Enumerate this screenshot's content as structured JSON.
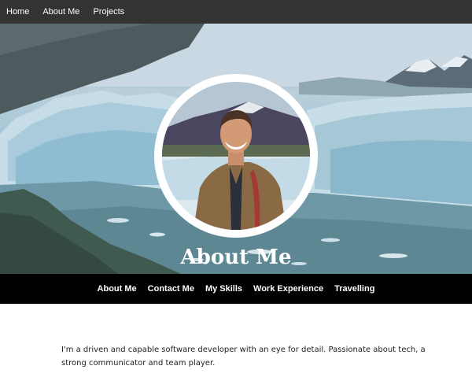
{
  "top_nav": {
    "items": [
      {
        "label": "Home"
      },
      {
        "label": "About Me"
      },
      {
        "label": "Projects"
      }
    ]
  },
  "hero": {
    "title": "About Me",
    "background_icon": "glacier-landscape",
    "avatar_icon": "profile-photo"
  },
  "section_nav": {
    "items": [
      {
        "label": "About Me"
      },
      {
        "label": "Contact Me"
      },
      {
        "label": "My Skills"
      },
      {
        "label": "Work Experience"
      },
      {
        "label": "Travelling"
      }
    ]
  },
  "main": {
    "bio": "I'm a driven and capable software developer with an eye for detail. Passionate about tech, a strong communicator and team player."
  },
  "colors": {
    "top_nav_bg": "#333333",
    "section_nav_bg": "#000000",
    "text": "#222222"
  }
}
